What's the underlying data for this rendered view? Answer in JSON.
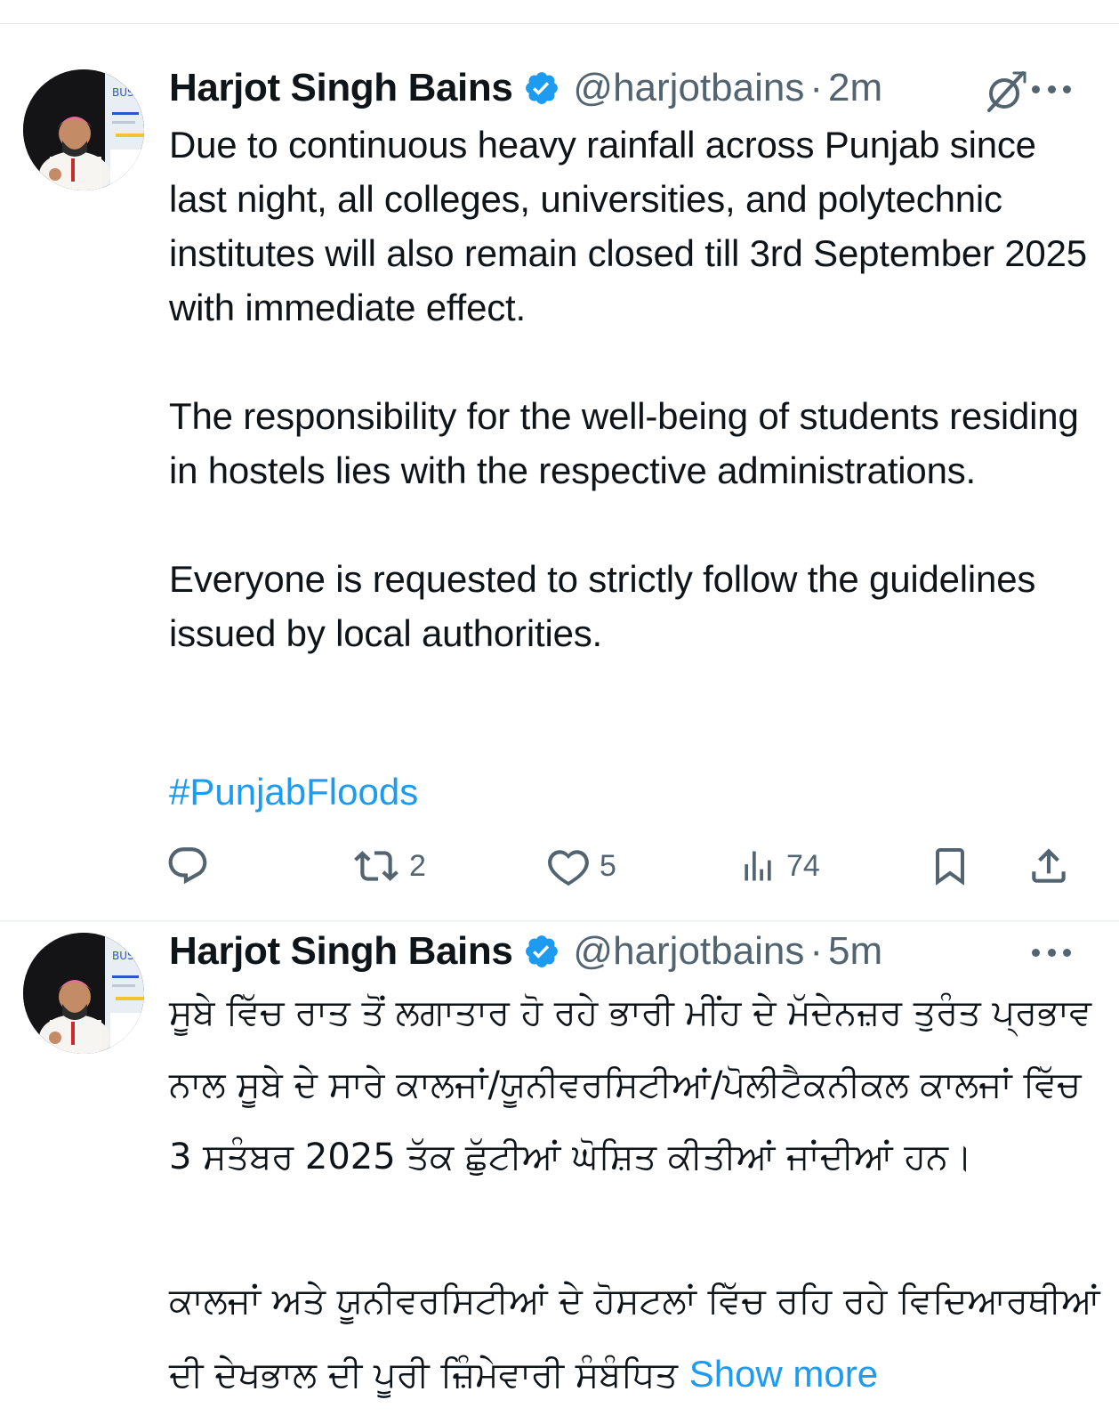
{
  "tweets": [
    {
      "author_name": "Harjot Singh Bains",
      "handle": "@harjotbains",
      "separator": "·",
      "time": "2m",
      "body": "Due to continuous heavy rainfall across Punjab since last night, all colleges, universities, and polytechnic institutes will also remain closed till 3rd September 2025 with immediate effect.\n\nThe responsibility for the well-being of students residing in hostels lies with the respective administrations.\n\nEveryone is requested to strictly follow the guidelines issued by local authorities.",
      "hashtag": "#PunjabFloods",
      "actions": {
        "reply_icon": "reply-icon",
        "retweet_icon": "retweet-icon",
        "retweets": "2",
        "like_icon": "heart-icon",
        "likes": "5",
        "views_icon": "views-icon",
        "views": "74",
        "bookmark_icon": "bookmark-icon",
        "share_icon": "share-icon"
      }
    },
    {
      "author_name": "Harjot Singh Bains",
      "handle": "@harjotbains",
      "separator": "·",
      "time": "5m",
      "body": "ਸੂਬੇ ਵਿੱਚ ਰਾਤ ਤੋਂ ਲਗਾਤਾਰ ਹੋ ਰਹੇ ਭਾਰੀ ਮੀਂਹ ਦੇ ਮੱਦੇਨਜ਼ਰ ਤੁਰੰਤ ਪ੍ਰਭਾਵ ਨਾਲ ਸੂਬੇ ਦੇ ਸਾਰੇ ਕਾਲਜਾਂ/ਯੂਨੀਵਰਸਿਟੀਆਂ/ਪੋਲੀਟੈਕਨੀਕਲ ਕਾਲਜਾਂ ਵਿੱਚ 3 ਸਤੰਬਰ 2025 ਤੱਕ ਛੁੱਟੀਆਂ ਘੋਸ਼ਿਤ ਕੀਤੀਆਂ ਜਾਂਦੀਆਂ ਹਨ।\n\nਕਾਲਜਾਂ ਅਤੇ ਯੂਨੀਵਰਸਿਟੀਆਂ ਦੇ ਹੋਸਟਲਾਂ ਵਿੱਚ ਰਹਿ ਰਹੇ ਵਿਦਿਆਰਥੀਆਂ ਦੀ ਦੇਖਭਾਲ ਦੀ ਪੂਰੀ ਜ਼ਿੰਮੇਵਾਰੀ ਸੰਬੰਧਿਤ",
      "show_more": "Show more"
    }
  ],
  "icons": {
    "verified": "verified-badge-icon",
    "grok": "grok-icon",
    "more": "more-options-icon"
  },
  "colors": {
    "accent": "#1d9bf0",
    "secondary_text": "#536471",
    "primary_text": "#0f1419"
  }
}
